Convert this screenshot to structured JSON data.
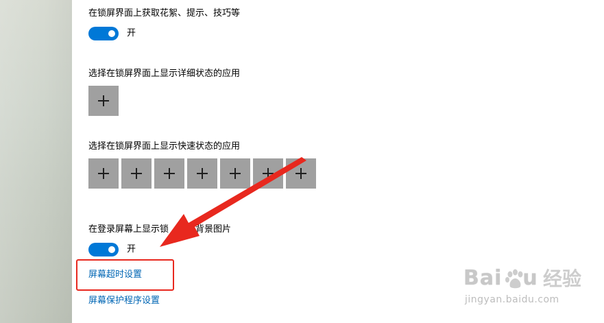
{
  "settings": {
    "lock_screen_tips_label": "在锁屏界面上获取花絮、提示、技巧等",
    "lock_screen_tips_toggle_state": "开",
    "detailed_status_label": "选择在锁屏界面上显示详细状态的应用",
    "quick_status_label": "选择在锁屏界面上显示快速状态的应用",
    "signin_background_label_before": "在登录屏幕上显示锁",
    "signin_background_label_after": "面背景图片",
    "signin_background_toggle_state": "开",
    "screen_timeout_link": "屏幕超时设置",
    "screensaver_link": "屏幕保护程序设置"
  },
  "quick_status_slots": 7,
  "detailed_status_slots": 1,
  "annotations": {
    "arrow_color": "#e8281e",
    "highlight_color": "#e8281e"
  },
  "watermark": {
    "brand_prefix": "Bai",
    "brand_suffix": "u",
    "brand_cn": "经验",
    "url": "jingyan.baidu.com"
  },
  "colors": {
    "toggle_on": "#0078d7",
    "link": "#0066b4",
    "tile": "#a0a0a0"
  }
}
